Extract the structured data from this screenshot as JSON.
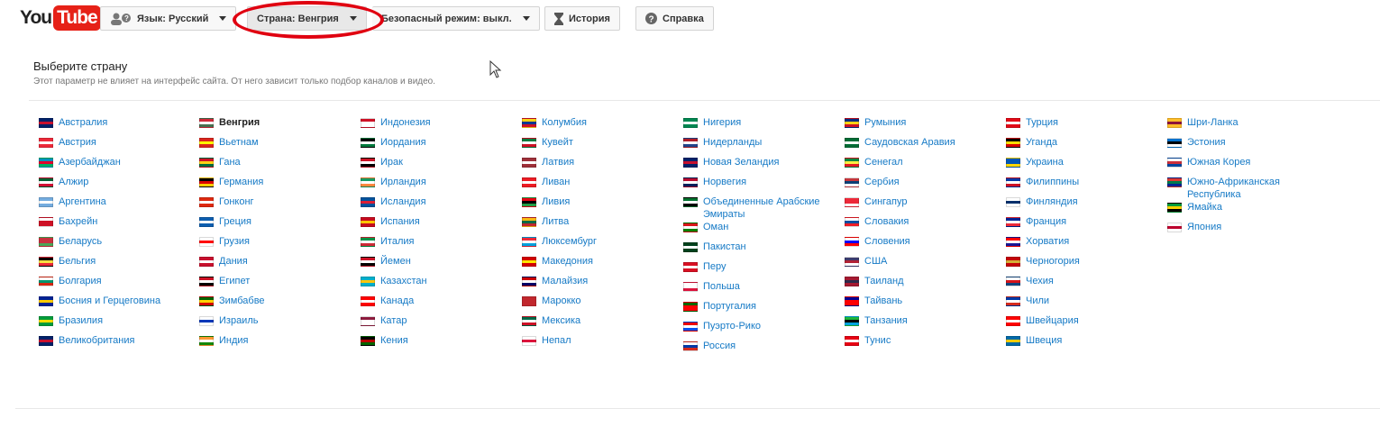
{
  "header": {
    "logo": "YouTube",
    "logo_you": "You",
    "logo_tube": "Tube",
    "language": "Язык: Русский",
    "country": "Страна: Венгрия",
    "safe_mode": "Безопасный режим: выкл.",
    "history": "История",
    "help": "Справка"
  },
  "panel": {
    "title": "Выберите страну",
    "subtitle": "Этот параметр не влияет на интерфейс сайта. От него зависит только подбор каналов и видео."
  },
  "selected": "Венгрия",
  "columns": [
    [
      [
        "Австралия",
        "#012169",
        "#c8102e",
        "#012169"
      ],
      [
        "Австрия",
        "#ed2939",
        "#fff",
        "#ed2939"
      ],
      [
        "Азербайджан",
        "#0092bc",
        "#e4002b",
        "#00af66"
      ],
      [
        "Алжир",
        "#006233",
        "#fff",
        "#d21034"
      ],
      [
        "Аргентина",
        "#74acdf",
        "#fff",
        "#74acdf"
      ],
      [
        "Бахрейн",
        "#fff",
        "#ce1126",
        "#ce1126"
      ],
      [
        "Беларусь",
        "#c8313e",
        "#c8313e",
        "#4aa657"
      ],
      [
        "Бельгия",
        "#000",
        "#fae042",
        "#ed2939"
      ],
      [
        "Болгария",
        "#fff",
        "#00966e",
        "#d62612"
      ],
      [
        "Босния и Герцеговина",
        "#002395",
        "#fecb00",
        "#002395"
      ],
      [
        "Бразилия",
        "#009c3b",
        "#ffdf00",
        "#009c3b"
      ],
      [
        "Великобритания",
        "#012169",
        "#c8102e",
        "#012169"
      ]
    ],
    [
      [
        "Венгрия",
        "#ce2939",
        "#fff",
        "#477050"
      ],
      [
        "Вьетнам",
        "#da251d",
        "#ff0",
        "#da251d"
      ],
      [
        "Гана",
        "#ce1126",
        "#fcd116",
        "#006b3f"
      ],
      [
        "Германия",
        "#000",
        "#dd0000",
        "#ffce00"
      ],
      [
        "Гонконг",
        "#de2910",
        "#fff",
        "#de2910"
      ],
      [
        "Греция",
        "#0d5eaf",
        "#fff",
        "#0d5eaf"
      ],
      [
        "Грузия",
        "#fff",
        "#ff0000",
        "#fff"
      ],
      [
        "Дания",
        "#c8102e",
        "#fff",
        "#c8102e"
      ],
      [
        "Египет",
        "#ce1126",
        "#fff",
        "#000"
      ],
      [
        "Зимбабве",
        "#006400",
        "#ffd200",
        "#d40000"
      ],
      [
        "Израиль",
        "#fff",
        "#0038b8",
        "#fff"
      ],
      [
        "Индия",
        "#ff9933",
        "#fff",
        "#138808"
      ]
    ],
    [
      [
        "Индонезия",
        "#ce1126",
        "#fff",
        "#fff"
      ],
      [
        "Иордания",
        "#000",
        "#fff",
        "#007a3d"
      ],
      [
        "Ирак",
        "#ce1126",
        "#fff",
        "#000"
      ],
      [
        "Ирландия",
        "#169b62",
        "#fff",
        "#ff883e"
      ],
      [
        "Исландия",
        "#02529c",
        "#dc1e35",
        "#02529c"
      ],
      [
        "Испания",
        "#c60b1e",
        "#ffc400",
        "#c60b1e"
      ],
      [
        "Италия",
        "#009246",
        "#fff",
        "#ce2b37"
      ],
      [
        "Йемен",
        "#ce1126",
        "#fff",
        "#000"
      ],
      [
        "Казахстан",
        "#00afca",
        "#fec50c",
        "#00afca"
      ],
      [
        "Канада",
        "#ff0000",
        "#fff",
        "#ff0000"
      ],
      [
        "Катар",
        "#8d1b3d",
        "#fff",
        "#fff"
      ],
      [
        "Кения",
        "#000",
        "#bb0000",
        "#006600"
      ]
    ],
    [
      [
        "Колумбия",
        "#fcd116",
        "#003893",
        "#ce1126"
      ],
      [
        "Кувейт",
        "#007a3d",
        "#fff",
        "#ce1126"
      ],
      [
        "Латвия",
        "#9e3039",
        "#fff",
        "#9e3039"
      ],
      [
        "Ливан",
        "#ed1c24",
        "#fff",
        "#ed1c24"
      ],
      [
        "Ливия",
        "#e70013",
        "#000",
        "#239e46"
      ],
      [
        "Литва",
        "#fdb913",
        "#006a44",
        "#c1272d"
      ],
      [
        "Люксембург",
        "#ed2939",
        "#fff",
        "#00a1de"
      ],
      [
        "Македония",
        "#d20000",
        "#ffe600",
        "#d20000"
      ],
      [
        "Малайзия",
        "#cc0001",
        "#fff",
        "#010066"
      ],
      [
        "Марокко",
        "#c1272d",
        "#c1272d",
        "#c1272d"
      ],
      [
        "Мексика",
        "#006847",
        "#fff",
        "#ce1126"
      ],
      [
        "Непал",
        "#fff",
        "#dc143c",
        "#fff"
      ]
    ],
    [
      [
        "Нигерия",
        "#008751",
        "#fff",
        "#008751"
      ],
      [
        "Нидерланды",
        "#ae1c28",
        "#fff",
        "#21468b"
      ],
      [
        "Новая Зеландия",
        "#012169",
        "#c8102e",
        "#012169"
      ],
      [
        "Норвегия",
        "#ba0c2f",
        "#fff",
        "#00205b"
      ],
      [
        "Объединенные Арабские Эмираты",
        "#00732f",
        "#fff",
        "#000"
      ],
      [
        "Оман",
        "#db161b",
        "#fff",
        "#008000"
      ],
      [
        "Пакистан",
        "#01411c",
        "#fff",
        "#01411c"
      ],
      [
        "Перу",
        "#d91023",
        "#fff",
        "#d91023"
      ],
      [
        "Польша",
        "#fff",
        "#fff",
        "#dc143c"
      ],
      [
        "Португалия",
        "#006600",
        "#ff0000",
        "#ff0000"
      ],
      [
        "Пуэрто-Рико",
        "#ed0000",
        "#fff",
        "#0050f0"
      ],
      [
        "Россия",
        "#fff",
        "#0039a6",
        "#d52b1e"
      ]
    ],
    [
      [
        "Румыния",
        "#002b7f",
        "#fcd116",
        "#ce1126"
      ],
      [
        "Саудовская Аравия",
        "#006c35",
        "#fff",
        "#006c35"
      ],
      [
        "Сенегал",
        "#00853f",
        "#fdef42",
        "#e31b23"
      ],
      [
        "Сербия",
        "#c6363c",
        "#0c4076",
        "#fff"
      ],
      [
        "Сингапур",
        "#ed2939",
        "#ed2939",
        "#fff"
      ],
      [
        "Словакия",
        "#fff",
        "#0b4ea2",
        "#ee1c25"
      ],
      [
        "Словения",
        "#fff",
        "#0000ff",
        "#ff0000"
      ],
      [
        "США",
        "#3c3b6e",
        "#b22234",
        "#fff"
      ],
      [
        "Таиланд",
        "#a51931",
        "#2d2a4a",
        "#a51931"
      ],
      [
        "Тайвань",
        "#000095",
        "#fe0000",
        "#fe0000"
      ],
      [
        "Танзания",
        "#1eb53a",
        "#000",
        "#00a3dd"
      ],
      [
        "Тунис",
        "#e70013",
        "#fff",
        "#e70013"
      ]
    ],
    [
      [
        "Турция",
        "#e30a17",
        "#fff",
        "#e30a17"
      ],
      [
        "Уганда",
        "#000",
        "#fcdc04",
        "#d90000"
      ],
      [
        "Украина",
        "#0057b7",
        "#0057b7",
        "#ffd700"
      ],
      [
        "Филиппины",
        "#0038a8",
        "#fff",
        "#ce1126"
      ],
      [
        "Финляндия",
        "#fff",
        "#002f6c",
        "#fff"
      ],
      [
        "Франция",
        "#002395",
        "#fff",
        "#ed2939"
      ],
      [
        "Хорватия",
        "#ff0000",
        "#fff",
        "#171796"
      ],
      [
        "Черногория",
        "#c40308",
        "#d4af37",
        "#c40308"
      ],
      [
        "Чехия",
        "#fff",
        "#d7141a",
        "#11457e"
      ],
      [
        "Чили",
        "#0039a6",
        "#fff",
        "#d52b1e"
      ],
      [
        "Швейцария",
        "#ff0000",
        "#fff",
        "#ff0000"
      ],
      [
        "Швеция",
        "#006aa7",
        "#fecc00",
        "#006aa7"
      ]
    ],
    [
      [
        "Шри-Ланка",
        "#ffbe29",
        "#8d153a",
        "#ffbe29"
      ],
      [
        "Эстония",
        "#0072ce",
        "#000",
        "#fff"
      ],
      [
        "Южная Корея",
        "#fff",
        "#cd2e3a",
        "#0047a0"
      ],
      [
        "Южно-Африканская Республика",
        "#de3831",
        "#007a4d",
        "#002395"
      ],
      [
        "Ямайка",
        "#009b3a",
        "#fed100",
        "#000"
      ],
      [
        "Япония",
        "#fff",
        "#bc002d",
        "#fff"
      ]
    ]
  ]
}
